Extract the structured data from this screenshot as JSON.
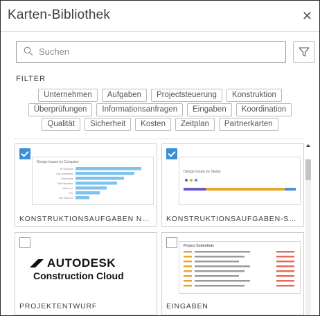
{
  "header": {
    "title": "Karten-Bibliothek",
    "close_icon": "close-icon"
  },
  "search": {
    "placeholder": "Suchen"
  },
  "filter": {
    "label": "FILTER",
    "rows": [
      [
        "Unternehmen",
        "Aufgaben",
        "Projectsteuerung",
        "Konstruktion"
      ],
      [
        "Überprüfungen",
        "Informationsanfragen",
        "Eingaben",
        "Koordination"
      ],
      [
        "Qualität",
        "Sicherheit",
        "Kosten",
        "Zeitplan",
        "Partnerkarten"
      ]
    ]
  },
  "cards": [
    {
      "name": "KONSTRUKTIONSAUFGABEN NACH UN...",
      "checked": true,
      "preview_title": "Design Issues by Company",
      "bar_labels": [
        "RI Soluzione",
        "Lam Enterprises",
        "Supercheck",
        "Steel Manufact.",
        "Water Ltd.",
        "Pico",
        "Rite 2004 Ltd."
      ],
      "bar_values": [
        0.95,
        0.85,
        0.7,
        0.6,
        0.45,
        0.35,
        0.2
      ]
    },
    {
      "name": "KONSTRUKTIONSAUFGABEN-STATUS",
      "checked": true,
      "preview_title": "Design Issues by Status",
      "status_colors": [
        "#6a5acd",
        "#e6a72b",
        "#4a90d9"
      ],
      "status_split": [
        0.2,
        0.7,
        0.1
      ]
    },
    {
      "name": "PROJEKTENTWURF",
      "checked": false,
      "logo_line1": "AUTODESK",
      "logo_line2": "Construction Cloud"
    },
    {
      "name": "EINGABEN",
      "checked": false,
      "preview_title": "Project Submittals",
      "rows": 8
    }
  ],
  "colors": {
    "accent": "#3a8fd6",
    "bar": "#7ec3ee"
  }
}
